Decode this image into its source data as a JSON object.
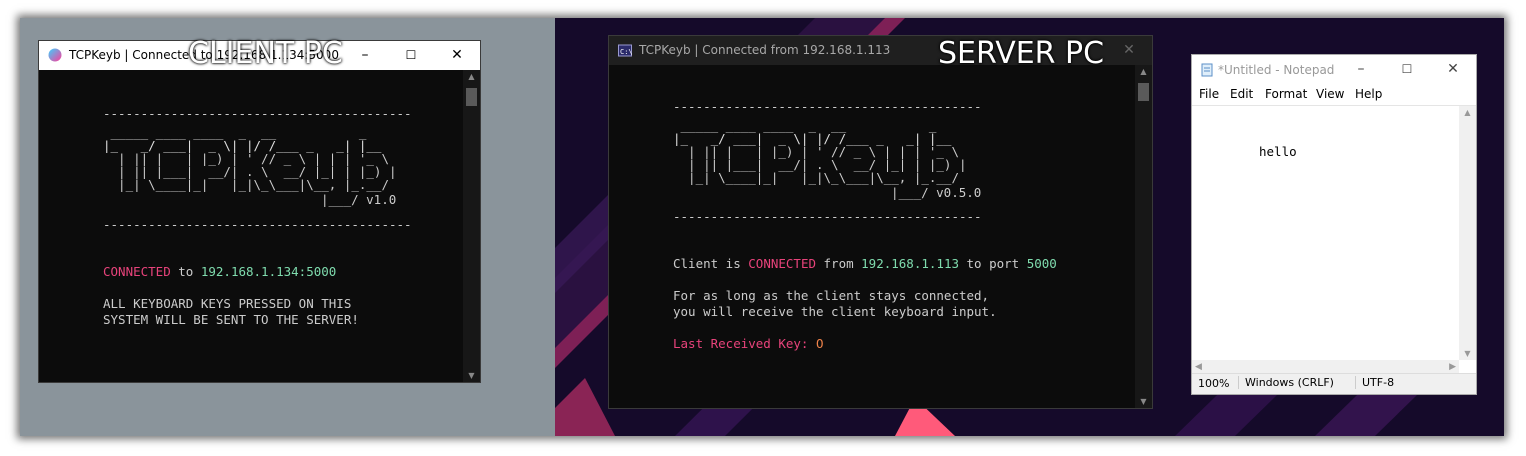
{
  "client": {
    "window_title": "TCPKeyb | Connected to 192.168.1.134:5000",
    "overlay_label": "CLIENT PC",
    "divider": "-----------------------------------------",
    "version": "|___/ v1.0",
    "status_word": "CONNECTED",
    "to_word": " to ",
    "address": "192.168.1.134:5000",
    "notice_line1": "ALL KEYBOARD KEYS PRESSED ON THIS",
    "notice_line2": "SYSTEM WILL BE SENT TO THE SERVER!"
  },
  "server": {
    "window_title": "TCPKeyb | Connected from 192.168.1.113",
    "overlay_label": "SERVER PC",
    "divider": "-----------------------------------------",
    "version": "|___/ v0.5.0",
    "client_is": "Client is ",
    "status_word": "CONNECTED",
    "from_word": " from ",
    "ip": "192.168.1.113",
    "to_port": " to port ",
    "port": "5000",
    "info_line1": "For as long as the client stays connected,",
    "info_line2": "you will receive the client keyboard input.",
    "last_key_label": "Last Received Key: ",
    "last_key_value": "O"
  },
  "ascii_logo": {
    "line1": " _____ ____ ____  _  __           _",
    "line2": "|_   _/ ___|  _ \\| |/ /___ _   _| |__",
    "line3": "  | || |   | |_) | ' // _ \\ | | | '_ \\",
    "line4": "  | || |___|  __/| . \\  __/ |_| | |_) |",
    "line5": "  |_| \\____|_|   |_|\\_\\___|\\__, |_.__/"
  },
  "notepad": {
    "window_title": "*Untitled - Notepad",
    "menu": [
      "File",
      "Edit",
      "Format",
      "View",
      "Help"
    ],
    "content": "hello",
    "status_zoom": "100%",
    "status_eol": "Windows (CRLF)",
    "status_encoding": "UTF-8"
  },
  "window_controls": {
    "minimize": "–",
    "maximize": "☐",
    "close": "✕"
  },
  "colors": {
    "pink": "#e8437b",
    "cyan": "#30c6d1",
    "green": "#7fdcae",
    "orange": "#f0834a",
    "console_bg": "#0c0c0c",
    "client_desktop": "#8a949b",
    "server_desktop": "#150a2a"
  }
}
